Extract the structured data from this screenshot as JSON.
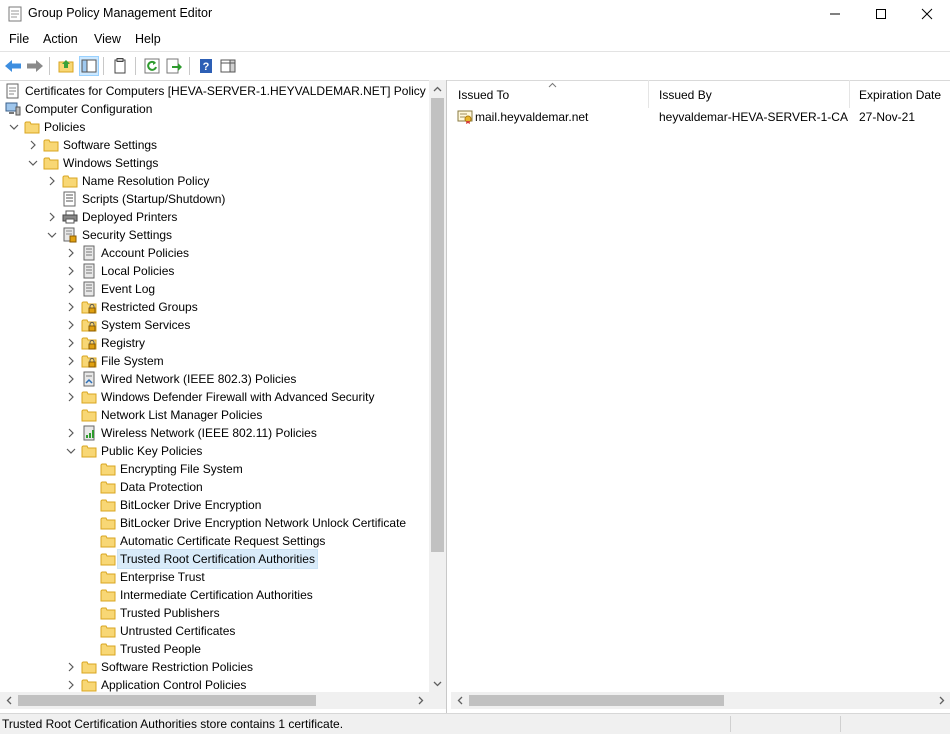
{
  "window": {
    "title": "Group Policy Management Editor"
  },
  "menu": [
    "File",
    "Action",
    "View",
    "Help"
  ],
  "toolbar": {
    "buttons": [
      "back-icon",
      "forward-icon",
      "up-folder-icon",
      "show-hide-tree-icon",
      "properties-icon",
      "refresh-icon",
      "export-list-icon",
      "help-icon",
      "show-action-pane-icon"
    ]
  },
  "tree": {
    "items": [
      {
        "label": "Certificates for Computers [HEVA-SERVER-1.HEYVALDEMAR.NET] Policy",
        "level": 0,
        "chevron": "none",
        "icon": "policy"
      },
      {
        "label": "Computer Configuration",
        "level": 0,
        "chevron": "expanded",
        "icon": "computer"
      },
      {
        "label": "Policies",
        "level": 1,
        "chevron": "expanded",
        "icon": "folder"
      },
      {
        "label": "Software Settings",
        "level": 2,
        "chevron": "collapsed",
        "icon": "folder"
      },
      {
        "label": "Windows Settings",
        "level": 2,
        "chevron": "expanded",
        "icon": "folder"
      },
      {
        "label": "Name Resolution Policy",
        "level": 3,
        "chevron": "collapsed",
        "icon": "folder"
      },
      {
        "label": "Scripts (Startup/Shutdown)",
        "level": 3,
        "chevron": "none",
        "icon": "script"
      },
      {
        "label": "Deployed Printers",
        "level": 3,
        "chevron": "collapsed",
        "icon": "printer"
      },
      {
        "label": "Security Settings",
        "level": 3,
        "chevron": "expanded",
        "icon": "security"
      },
      {
        "label": "Account Policies",
        "level": 4,
        "chevron": "collapsed",
        "icon": "policy-doc"
      },
      {
        "label": "Local Policies",
        "level": 4,
        "chevron": "collapsed",
        "icon": "policy-doc"
      },
      {
        "label": "Event Log",
        "level": 4,
        "chevron": "collapsed",
        "icon": "policy-doc"
      },
      {
        "label": "Restricted Groups",
        "level": 4,
        "chevron": "collapsed",
        "icon": "locked-folder"
      },
      {
        "label": "System Services",
        "level": 4,
        "chevron": "collapsed",
        "icon": "locked-folder"
      },
      {
        "label": "Registry",
        "level": 4,
        "chevron": "collapsed",
        "icon": "locked-folder"
      },
      {
        "label": "File System",
        "level": 4,
        "chevron": "collapsed",
        "icon": "locked-folder"
      },
      {
        "label": "Wired Network (IEEE 802.3) Policies",
        "level": 4,
        "chevron": "collapsed",
        "icon": "wired-network"
      },
      {
        "label": "Windows Defender Firewall with Advanced Security",
        "level": 4,
        "chevron": "collapsed",
        "icon": "folder"
      },
      {
        "label": "Network List Manager Policies",
        "level": 4,
        "chevron": "none",
        "icon": "folder"
      },
      {
        "label": "Wireless Network (IEEE 802.11) Policies",
        "level": 4,
        "chevron": "collapsed",
        "icon": "wireless-network"
      },
      {
        "label": "Public Key Policies",
        "level": 4,
        "chevron": "expanded",
        "icon": "folder"
      },
      {
        "label": "Encrypting File System",
        "level": 5,
        "chevron": "none",
        "icon": "folder"
      },
      {
        "label": "Data Protection",
        "level": 5,
        "chevron": "none",
        "icon": "folder"
      },
      {
        "label": "BitLocker Drive Encryption",
        "level": 5,
        "chevron": "none",
        "icon": "folder"
      },
      {
        "label": "BitLocker Drive Encryption Network Unlock Certificate",
        "level": 5,
        "chevron": "none",
        "icon": "folder"
      },
      {
        "label": "Automatic Certificate Request Settings",
        "level": 5,
        "chevron": "none",
        "icon": "folder"
      },
      {
        "label": "Trusted Root Certification Authorities",
        "level": 5,
        "chevron": "none",
        "icon": "folder",
        "selected": true
      },
      {
        "label": "Enterprise Trust",
        "level": 5,
        "chevron": "none",
        "icon": "folder"
      },
      {
        "label": "Intermediate Certification Authorities",
        "level": 5,
        "chevron": "none",
        "icon": "folder"
      },
      {
        "label": "Trusted Publishers",
        "level": 5,
        "chevron": "none",
        "icon": "folder"
      },
      {
        "label": "Untrusted Certificates",
        "level": 5,
        "chevron": "none",
        "icon": "folder"
      },
      {
        "label": "Trusted People",
        "level": 5,
        "chevron": "none",
        "icon": "folder"
      },
      {
        "label": "Software Restriction Policies",
        "level": 4,
        "chevron": "collapsed",
        "icon": "folder"
      },
      {
        "label": "Application Control Policies",
        "level": 4,
        "chevron": "collapsed",
        "icon": "folder"
      }
    ]
  },
  "list": {
    "columns": [
      "Issued To",
      "Issued By",
      "Expiration Date"
    ],
    "rows": [
      {
        "issued_to": "mail.heyvaldemar.net",
        "issued_by": "heyvaldemar-HEVA-SERVER-1-CA",
        "expiration": "27-Nov-21"
      }
    ]
  },
  "status": {
    "text": "Trusted Root Certification Authorities store contains 1 certificate."
  },
  "colors": {
    "selection": "#d9ebf9",
    "folder": "#f8d775",
    "folder_edge": "#d9a620",
    "scroll_thumb": "#c1c1c1"
  }
}
